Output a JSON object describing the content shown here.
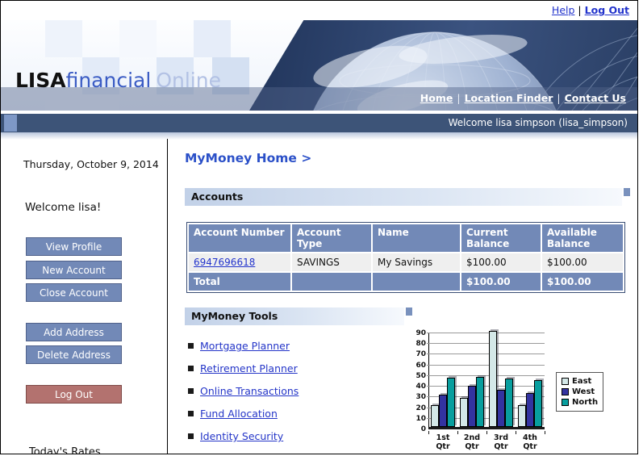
{
  "utility": {
    "help": "Help",
    "separator": "|",
    "logout": "Log Out"
  },
  "brand": {
    "part1": "LISA",
    "part2": "financial",
    "part3": "Online"
  },
  "nav": {
    "home": "Home",
    "separator": "|",
    "location_finder": "Location Finder",
    "contact_us": "Contact Us"
  },
  "welcome_bar": {
    "text": "Welcome lisa simpson (lisa_simpson)"
  },
  "sidebar": {
    "date": "Thursday, October 9, 2014",
    "greeting": "Welcome lisa!",
    "buttons": [
      "View Profile",
      "New Account",
      "Close Account",
      "Add Address",
      "Delete Address"
    ],
    "logout_button": "Log Out",
    "clipped_text": "Today's Rates"
  },
  "main": {
    "breadcrumb": "MyMoney Home >",
    "sections": {
      "accounts": "Accounts",
      "tools": "MyMoney Tools"
    },
    "table": {
      "headers": [
        "Account Number",
        "Account Type",
        "Name",
        "Current Balance",
        "Available Balance"
      ],
      "row": {
        "account_number": "6947696618",
        "account_type": "SAVINGS",
        "name": "My Savings",
        "current_balance": "$100.00",
        "available_balance": "$100.00"
      },
      "total": {
        "label": "Total",
        "current_balance": "$100.00",
        "available_balance": "$100.00"
      }
    },
    "tools": {
      "links": [
        "Mortgage Planner",
        "Retirement Planner",
        "Online Transactions",
        "Fund Allocation",
        "Identity Security"
      ]
    }
  },
  "colors": {
    "button_blue": "#7289b7",
    "logout_red": "#b3726f",
    "welcome_bar_navy": "#3d5478",
    "link_blue": "#2233cc",
    "table_header_blue": "#7289b7"
  },
  "chart_data": {
    "type": "bar",
    "title": "",
    "categories": [
      "1st Qtr",
      "2nd Qtr",
      "3rd Qtr",
      "4th Qtr"
    ],
    "series": [
      {
        "name": "East",
        "color": "#d4e8e8",
        "values": [
          20.4,
          27.4,
          90,
          20.4
        ]
      },
      {
        "name": "West",
        "color": "#3333a0",
        "values": [
          30.6,
          38.6,
          34.6,
          31.6
        ]
      },
      {
        "name": "North",
        "color": "#089e9e",
        "values": [
          45.9,
          46.9,
          45,
          43.9
        ]
      }
    ],
    "xlabel": "",
    "ylabel": "",
    "ylim": [
      0,
      90
    ],
    "ytick_step": 10,
    "grid": true,
    "legend_position": "right"
  }
}
